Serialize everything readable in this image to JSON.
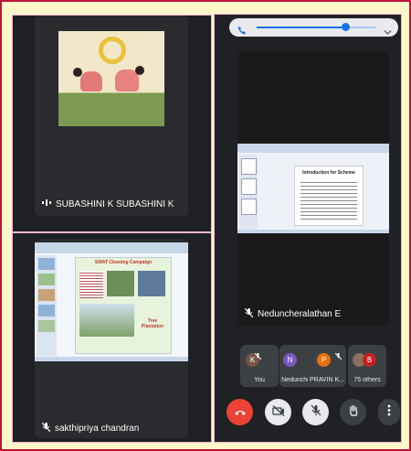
{
  "tiles": {
    "top_left": {
      "name": "SUBASHINI K SUBASHINI K"
    },
    "bottom_left": {
      "name": "sakthipriya chandran"
    },
    "main": {
      "name": "Neduncheralathan E"
    }
  },
  "slides": {
    "main_title": "Introduction for Scheme",
    "campaign_title": "SWAT Cleaning Campaign",
    "campaign_footer": "Tree Plantation"
  },
  "participants": [
    {
      "initial": "K",
      "label": "You",
      "color": "#795548"
    },
    {
      "initial": "N",
      "label": "Neduncheralathan E",
      "short": "Nedunche...",
      "color": "#7e57c2"
    },
    {
      "initial": "P",
      "label": "PRAVIN K",
      "short": "PRAVIN K...",
      "color": "#e8710a"
    },
    {
      "initial": "B",
      "label": "75 others",
      "color": "#c5221f"
    }
  ],
  "volume": {
    "level": 0.75
  },
  "colors": {
    "accent": "#8ab4f8",
    "end_call": "#ea4335",
    "bg": "#1f2023"
  }
}
